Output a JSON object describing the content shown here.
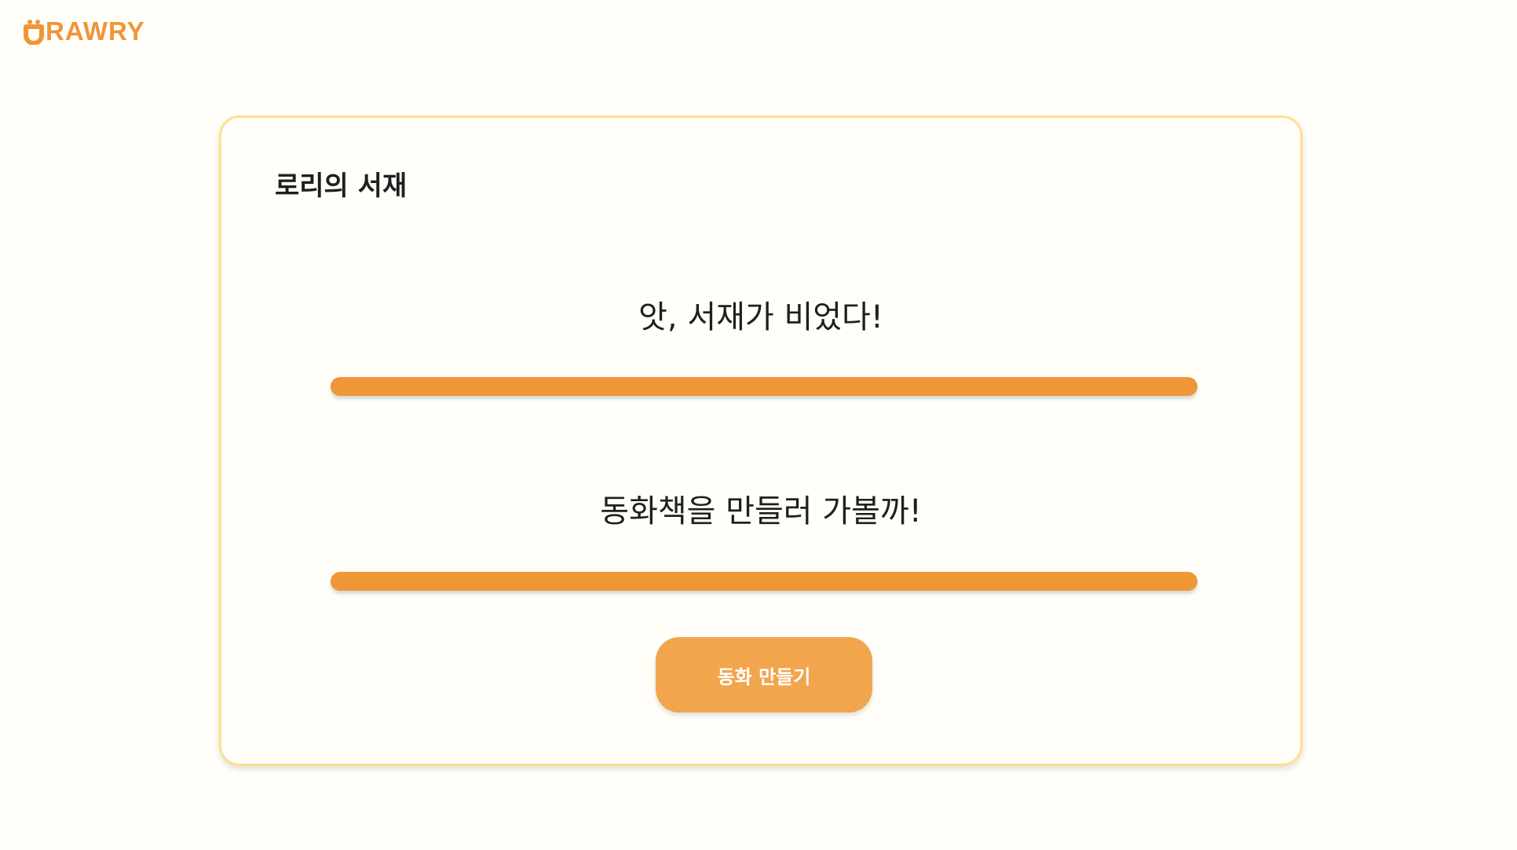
{
  "header": {
    "logo_text": "RAWRY",
    "logo_icon": "drawry-logo-icon"
  },
  "library": {
    "title": "로리의 서재",
    "empty_message": "앗, 서재가 비었다!",
    "prompt_message": "동화책을 만들러 가볼까!",
    "create_button_label": "동화 만들기"
  },
  "colors": {
    "accent": "#ef9637",
    "button": "#f2a54c",
    "card_border": "#fbe28c",
    "background": "#fffef9",
    "text": "#1f1f1f"
  }
}
